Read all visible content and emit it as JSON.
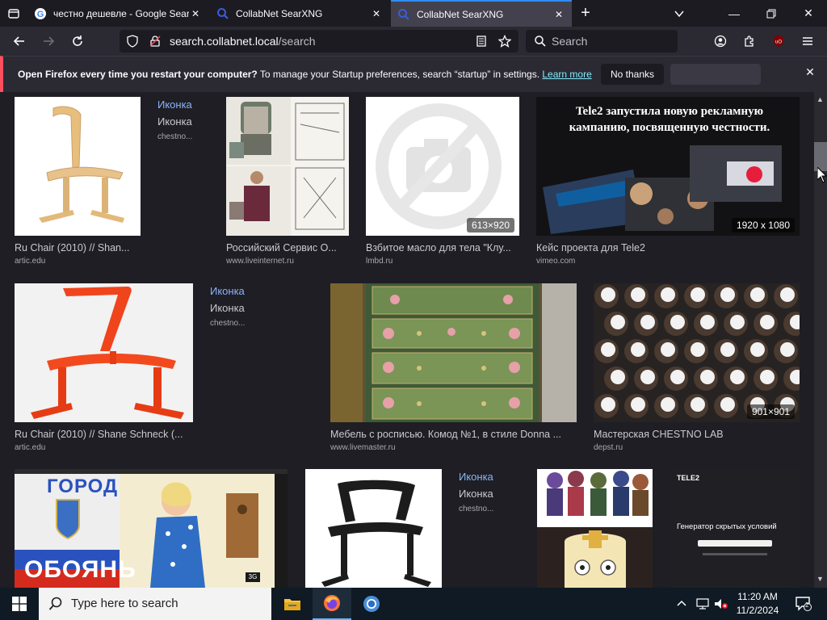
{
  "tabs": [
    {
      "title": "честно дешевле - Google Search",
      "active": false
    },
    {
      "title": "CollabNet SearXNG",
      "active": false
    },
    {
      "title": "CollabNet SearXNG",
      "active": true
    }
  ],
  "nav": {
    "url_host": "search.collabnet.local",
    "url_path": "/search",
    "search_placeholder": "Search"
  },
  "notification": {
    "bold": "Open Firefox every time you restart your computer?",
    "text": " To manage your Startup preferences, search “startup” in settings. ",
    "link": "Learn more",
    "no_thanks": "No thanks"
  },
  "results": [
    {
      "caption": "Ru Chair (2010) // Shan...",
      "source": "artic.edu",
      "badge": "Иконка",
      "badge2": "Иконка",
      "badge3": "chestno..."
    },
    {
      "caption": "Российский Сервис О...",
      "source": "www.liveinternet.ru"
    },
    {
      "caption": "Взбитое масло для тела \"Клу...",
      "source": "lmbd.ru",
      "resolution": "613×920"
    },
    {
      "caption": "Кейс проекта для Tele2",
      "source": "vimeo.com",
      "resolution": "1920 x 1080",
      "headline": "Tele2 запустила новую рекламную кампанию, посвященную честности."
    },
    {
      "caption": "Ru Chair (2010) // Shane Schneck (...",
      "source": "artic.edu",
      "badge": "Иконка",
      "badge2": "Иконка",
      "badge3": "chestno..."
    },
    {
      "caption": "Мебель с росписью. Комод №1, в стиле Donna ...",
      "source": "www.livemaster.ru"
    },
    {
      "caption": "Мастерская CHESTNO LAB",
      "source": "depst.ru",
      "resolution": "901×901"
    },
    {
      "poster_top": "ГОРОД",
      "poster_bottom": "ОБОЯНЬ"
    },
    {
      "badge": "Иконка",
      "badge2": "Иконка",
      "badge3": "chestno..."
    },
    {},
    {
      "logo": "TELE2",
      "text": "Генератор скрытых условий"
    }
  ],
  "taskbar": {
    "search_placeholder": "Type here to search",
    "time": "11:20 AM",
    "date": "11/2/2024",
    "notifications": "2"
  }
}
